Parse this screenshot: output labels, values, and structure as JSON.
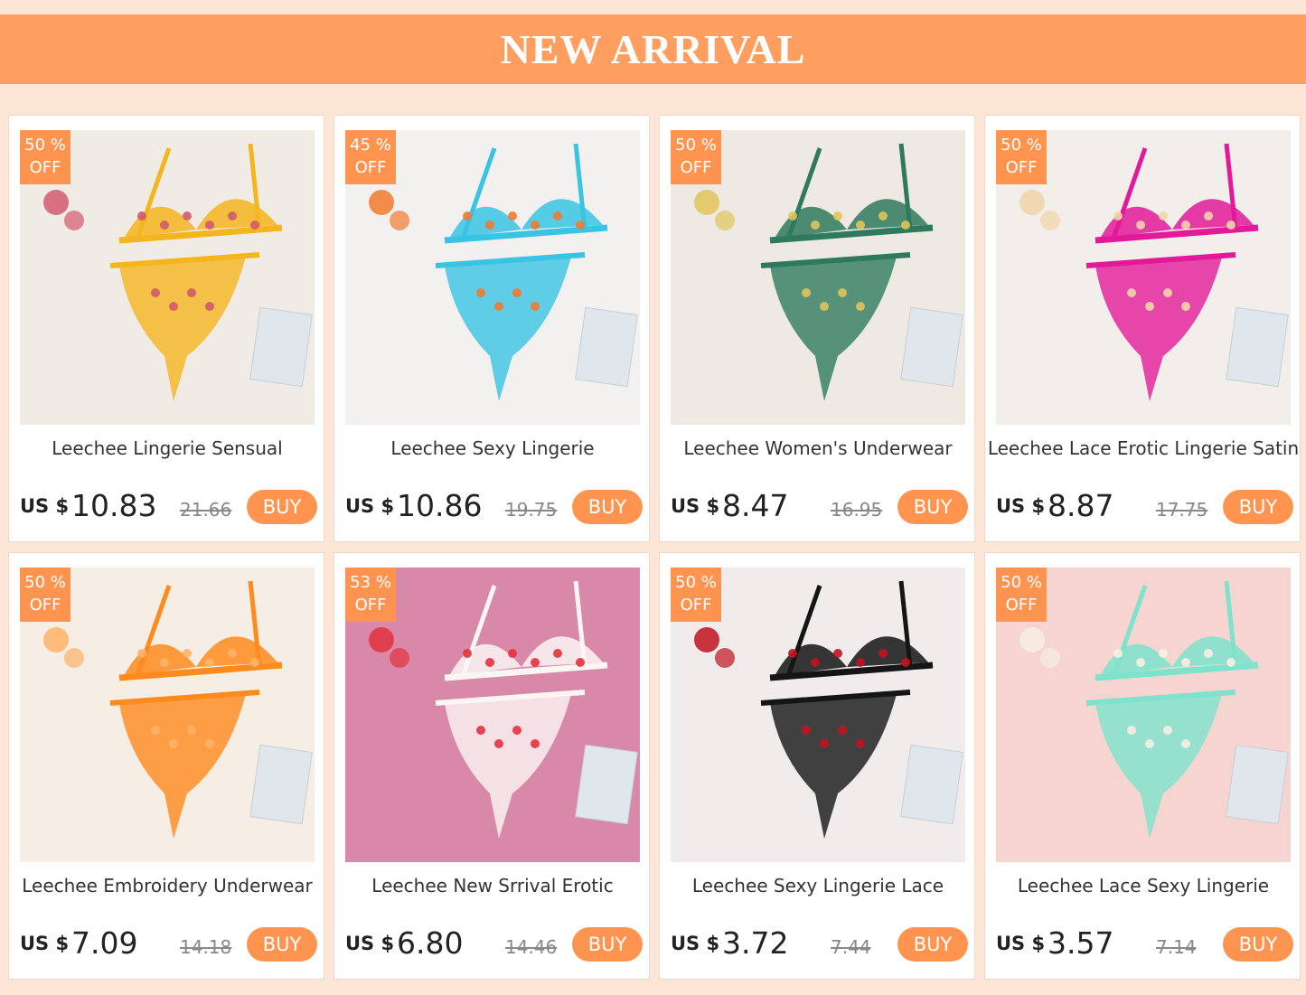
{
  "banner": {
    "title": "NEW ARRIVAL"
  },
  "currency_label": "US $",
  "colors": {
    "accent": "#ff9450",
    "banner": "#ff9e5e",
    "background": "#fde6d6"
  },
  "products": [
    {
      "name": "Leechee Lingerie Sensual",
      "discount_pct": "50 %",
      "discount_off": "OFF",
      "price": "10.83",
      "old_price": "21.66",
      "buy_label": "BUY",
      "photo_bg": "#f1ebe6",
      "item_color": "#f5b51f",
      "accent_color": "#d25a6d",
      "photo_alt": "yellow embroidered lingerie set"
    },
    {
      "name": "Leechee Sexy Lingerie",
      "discount_pct": "45 %",
      "discount_off": "OFF",
      "price": "10.86",
      "old_price": "19.75",
      "buy_label": "BUY",
      "photo_bg": "#f3f1f0",
      "item_color": "#39c4e3",
      "accent_color": "#f07a2e",
      "photo_alt": "blue floral lingerie set"
    },
    {
      "name": "Leechee Women's Underwear",
      "discount_pct": "50 %",
      "discount_off": "OFF",
      "price": "8.47",
      "old_price": "16.95",
      "buy_label": "BUY",
      "photo_bg": "#efe9e3",
      "item_color": "#2f7a5e",
      "accent_color": "#e0c45a",
      "photo_alt": "green floral lingerie set"
    },
    {
      "name": "Leechee Lace Erotic Lingerie Satin",
      "discount_pct": "50 %",
      "discount_off": "OFF",
      "price": "8.87",
      "old_price": "17.75",
      "buy_label": "BUY",
      "photo_bg": "#f2eee9",
      "item_color": "#e21a9a",
      "accent_color": "#f2d4a8",
      "photo_alt": "pink satin lingerie set"
    },
    {
      "name": "Leechee Embroidery Underwear",
      "discount_pct": "50 %",
      "discount_off": "OFF",
      "price": "7.09",
      "old_price": "14.18",
      "buy_label": "BUY",
      "photo_bg": "#f6eee4",
      "item_color": "#ff8a1e",
      "accent_color": "#ffb266",
      "photo_alt": "orange embroidered lingerie set"
    },
    {
      "name": "Leechee New Srrival Erotic",
      "discount_pct": "53 %",
      "discount_off": "OFF",
      "price": "6.80",
      "old_price": "14.46",
      "buy_label": "BUY",
      "photo_bg": "#d889a8",
      "item_color": "#fbf6f4",
      "accent_color": "#e2323f",
      "photo_alt": "white heart print lingerie set"
    },
    {
      "name": "Leechee Sexy Lingerie Lace",
      "discount_pct": "50 %",
      "discount_off": "OFF",
      "price": "3.72",
      "old_price": "7.44",
      "buy_label": "BUY",
      "photo_bg": "#f1ecec",
      "item_color": "#151515",
      "accent_color": "#c0131f",
      "photo_alt": "black lace lingerie set"
    },
    {
      "name": "Leechee Lace Sexy Lingerie",
      "discount_pct": "50 %",
      "discount_off": "OFF",
      "price": "3.57",
      "old_price": "7.14",
      "buy_label": "BUY",
      "photo_bg": "#f6d4d0",
      "item_color": "#7de3cc",
      "accent_color": "#f7efe2",
      "photo_alt": "mint lace lingerie set"
    }
  ]
}
